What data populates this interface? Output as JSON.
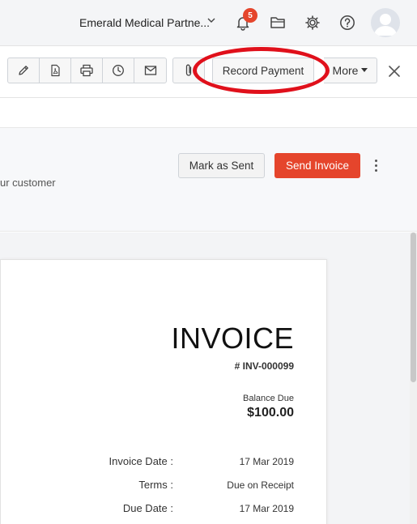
{
  "header": {
    "org_name": "Emerald Medical Partne...",
    "notification_count": "5",
    "icons": [
      "bell-icon",
      "folder-icon",
      "gear-icon",
      "help-icon",
      "avatar"
    ]
  },
  "toolbar": {
    "icons": [
      "pencil-icon",
      "pdf-icon",
      "printer-icon",
      "clock-icon",
      "mail-icon",
      "paperclip-icon"
    ],
    "record_payment_label": "Record Payment",
    "more_label": "More",
    "highlight_color": "#e0101b"
  },
  "banner": {
    "message": "ur customer",
    "mark_as_sent_label": "Mark as Sent",
    "send_invoice_label": "Send Invoice",
    "accent_color": "#e5452c"
  },
  "invoice": {
    "title": "INVOICE",
    "number": "# INV-000099",
    "balance_due_label": "Balance Due",
    "balance_due_value": "$100.00",
    "details": [
      {
        "label": "Invoice Date :",
        "value": "17 Mar 2019"
      },
      {
        "label": "Terms :",
        "value": "Due on Receipt"
      },
      {
        "label": "Due Date :",
        "value": "17 Mar 2019"
      }
    ]
  }
}
